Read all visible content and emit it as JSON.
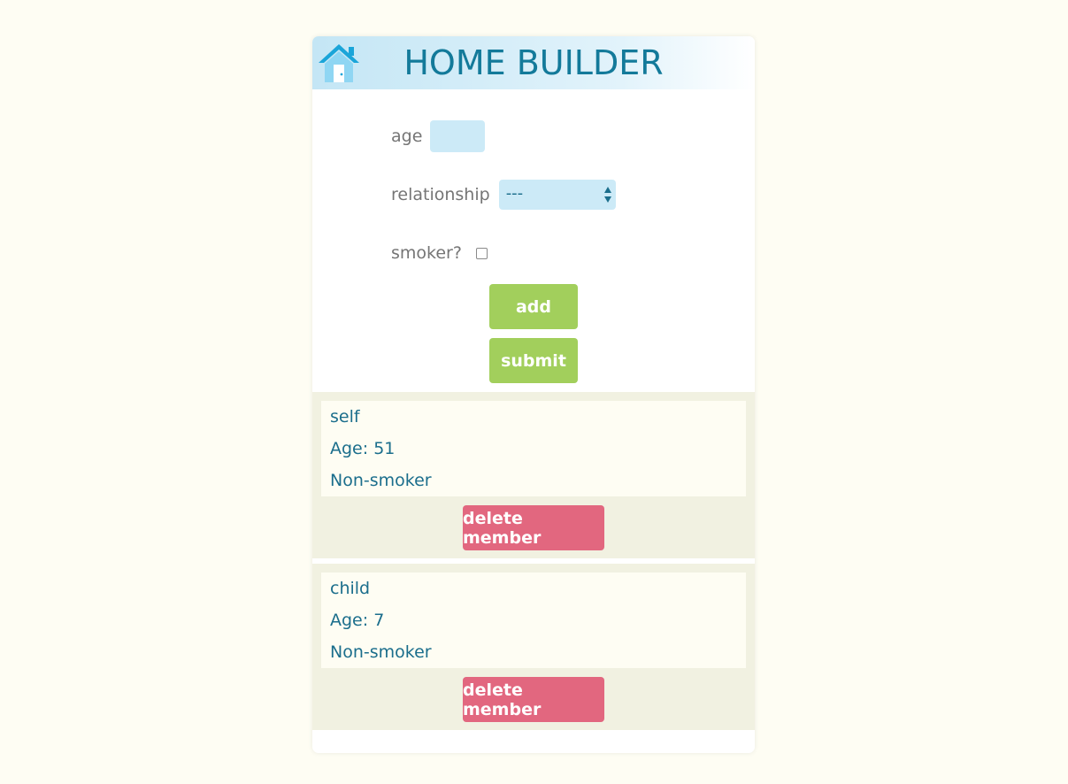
{
  "header": {
    "title": "HOME BUILDER",
    "logo_icon": "house-icon"
  },
  "form": {
    "age_label": "age",
    "age_value": "",
    "relationship_label": "relationship",
    "relationship_selected": "---",
    "smoker_label": "smoker?",
    "smoker_checked": false,
    "add_label": "add",
    "submit_label": "submit"
  },
  "members": [
    {
      "relationship": "self",
      "age_text": "Age: 51",
      "smoker_text": "Non-smoker",
      "delete_label": "delete member"
    },
    {
      "relationship": "child",
      "age_text": "Age: 7",
      "smoker_text": "Non-smoker",
      "delete_label": "delete member"
    }
  ],
  "colors": {
    "accent": "#137a9a",
    "green": "#a2cf5c",
    "delete": "#e2677f",
    "input_bg": "#cceaf7"
  }
}
